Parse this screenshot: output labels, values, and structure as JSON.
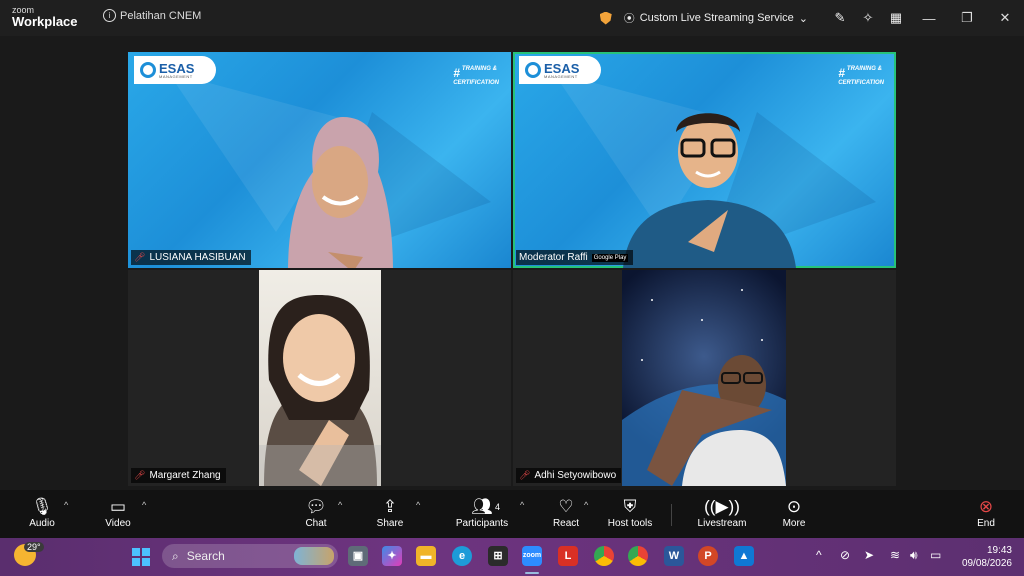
{
  "titlebar": {
    "brand_small": "zoom",
    "brand_big": "Workplace",
    "meeting_name": "Pelatihan CNEM",
    "streaming_label": "Custom Live Streaming Service"
  },
  "tiles": {
    "logo_text": "ESAS",
    "logo_subtext": "MANAGEMENT",
    "training_line1": "TRAINING &",
    "training_line2": "CERTIFICATION",
    "participant1": "LUSIANA HASIBUAN",
    "participant2": "Moderator Raffi",
    "participant2_overlay": "Google Play",
    "participant3": "Margaret Zhang",
    "participant4": "Adhi Setyowibowo"
  },
  "toolbar": {
    "audio": "Audio",
    "video": "Video",
    "chat": "Chat",
    "share": "Share",
    "participants": "Participants",
    "participants_count": "4",
    "react": "React",
    "host_tools": "Host tools",
    "livestream": "Livestream",
    "more": "More",
    "end": "End"
  },
  "taskbar": {
    "temperature": "29°",
    "search_placeholder": "Search",
    "time": "19:43",
    "date": "09/08/2026"
  }
}
